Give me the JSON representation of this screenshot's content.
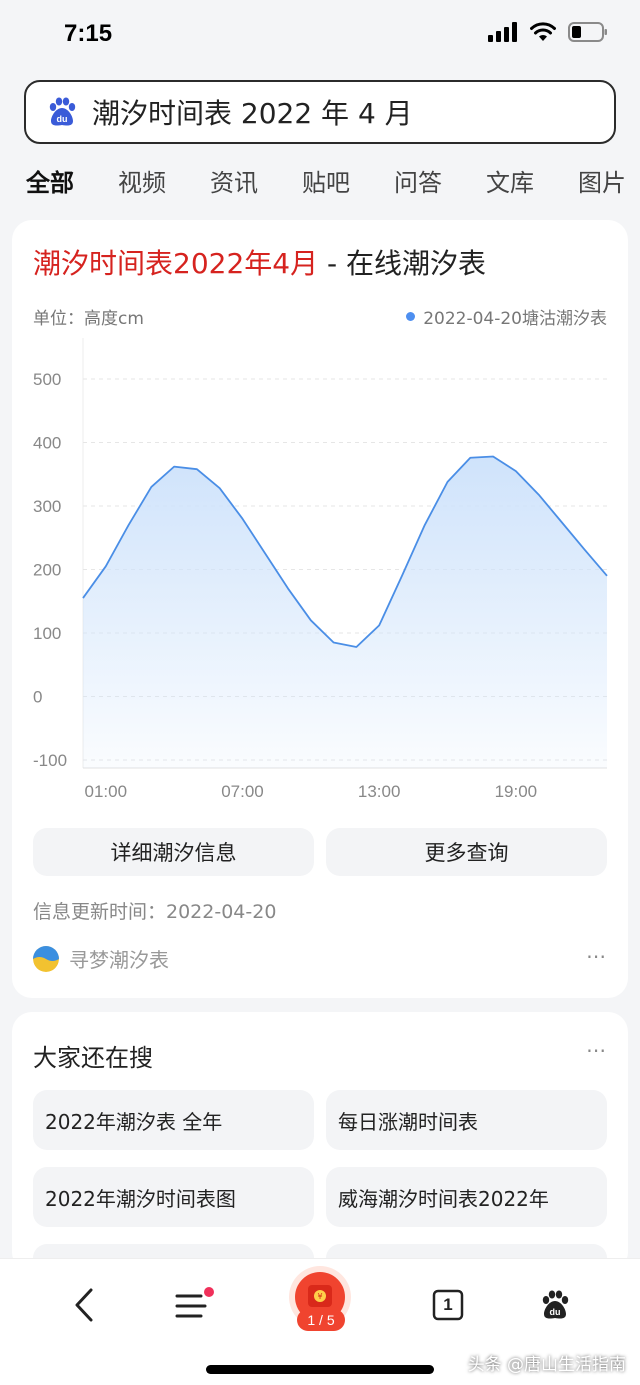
{
  "status_bar": {
    "time": "7:15"
  },
  "search": {
    "query": "潮汐时间表 2022 年 4 月"
  },
  "tabs": [
    {
      "label": "全部",
      "active": true
    },
    {
      "label": "视频",
      "active": false
    },
    {
      "label": "资讯",
      "active": false
    },
    {
      "label": "贴吧",
      "active": false
    },
    {
      "label": "问答",
      "active": false
    },
    {
      "label": "文库",
      "active": false
    },
    {
      "label": "图片",
      "active": false
    }
  ],
  "result": {
    "title_highlight": "潮汐时间表2022年4月",
    "title_rest": " - 在线潮汐表",
    "unit_label": "单位：高度cm",
    "legend_label": "2022-04-20塘沽潮汐表",
    "detail_button": "详细潮汐信息",
    "more_button": "更多查询",
    "update_time": "信息更新时间：2022-04-20",
    "source_name": "寻梦潮汐表",
    "more_icon": "⋯"
  },
  "chart_data": {
    "type": "area",
    "x_ticks": [
      "01:00",
      "07:00",
      "13:00",
      "19:00"
    ],
    "x": [
      0,
      1,
      2,
      3,
      4,
      5,
      6,
      7,
      8,
      9,
      10,
      11,
      12,
      13,
      14,
      15,
      16,
      17,
      18,
      19,
      20,
      21,
      22,
      23
    ],
    "y_ticks": [
      500,
      400,
      300,
      200,
      100,
      0,
      -100
    ],
    "ylim": [
      -100,
      550
    ],
    "values": [
      155,
      205,
      270,
      330,
      362,
      358,
      328,
      280,
      225,
      170,
      120,
      85,
      78,
      112,
      190,
      270,
      338,
      376,
      378,
      355,
      318,
      275,
      232,
      190
    ],
    "series_color": "#4a8ee6",
    "fill_color": "#cfe3fb",
    "grid": true
  },
  "related": {
    "title": "大家还在搜",
    "more_icon": "⋯",
    "items": [
      "2022年潮汐表 全年",
      "每日涨潮时间表",
      "2022年潮汐时间表图",
      "威海潮汐时间表2022年"
    ]
  },
  "bottom_bar": {
    "back_icon": "back-icon",
    "menu_icon": "menu-icon",
    "page_indicator": "1 / 5",
    "tab_count": "1",
    "paw_icon": "baidu-paw-icon"
  },
  "watermark": "头条 @唐山生活指南"
}
